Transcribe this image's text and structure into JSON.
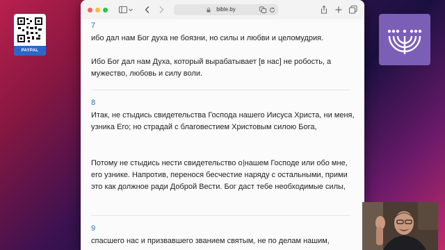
{
  "desktop": {
    "qr_widget_label": "PAYPAL"
  },
  "browser": {
    "address": "bible.by",
    "icons": [
      "sidebar-icon",
      "chevron-down-icon",
      "back-icon",
      "forward-icon",
      "lock-icon",
      "translate-icon",
      "reload-icon",
      "share-icon",
      "new-tab-icon",
      "tabs-overview-icon"
    ]
  },
  "verses": [
    {
      "number": "7",
      "text1": "ибо дал нам Бог духа не боязни, но силы и любви и целомудрия.",
      "text2": "Ибо Бог дал нам Духа, который вырабатывает [в нас] не робость, а мужество, любовь и силу воли."
    },
    {
      "number": "8",
      "text1": "Итак, не стыдись свидетельства Господа нашего Иисуса Христа, ни меня, узника Его; но страдай с благовестием Христовым силою Бога,",
      "text2_before": "Потому не стыдись нести свидетельство о",
      "text2_after": "нашем Господе или обо мне, его узнике. Напротив, перенося бесчестие наряду с остальными, прими это как должное ради Доброй Вести. Бог даст тебе необходимые силы,"
    },
    {
      "number": "9",
      "text1": "спасшего нас и призвавшего званием святым, не по делам нашим,"
    }
  ],
  "colors": {
    "verse_number": "#1f6fbf",
    "paypal": "#2b67c9",
    "logo_bg": "#7b5fb6"
  }
}
